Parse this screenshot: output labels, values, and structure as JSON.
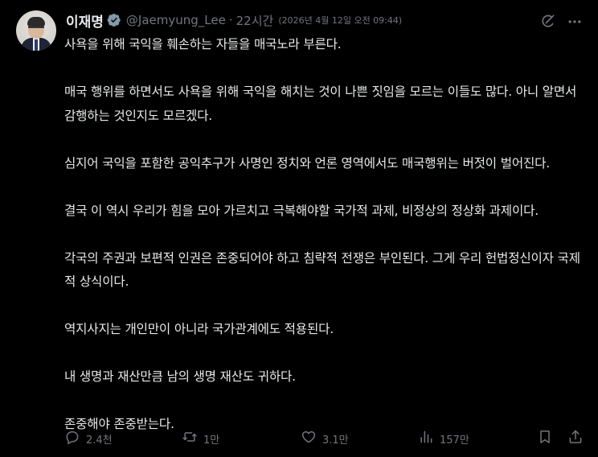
{
  "author": {
    "display_name": "이재명",
    "handle": "@Jaemyung_Lee",
    "verified": true
  },
  "timestamp": {
    "separator": "·",
    "relative": "22시간",
    "full": "(2026년 4월 12일 오전 09:44)"
  },
  "post": {
    "paragraphs": [
      "사욕을 위해 국익을 훼손하는 자들을 매국노라 부른다.",
      "매국 행위를 하면서도 사욕을 위해 국익을 해치는 것이 나쁜 짓임을 모르는 이들도 많다. 아니 알면서 감행하는 것인지도 모르겠다.",
      "심지어 국익을 포함한 공익추구가 사명인 정치와 언론 영역에서도 매국행위는 버젓이 벌어진다.",
      "결국 이 역시 우리가 힘을 모아 가르치고 극복해야할 국가적 과제, 비정상의 정상화 과제이다.",
      "각국의 주권과 보편적 인권은 존중되어야 하고 침략적 전쟁은 부인된다. 그게 우리 헌법정신이자 국제적 상식이다.",
      "역지사지는 개인만이 아니라 국가관계에도 적용된다.",
      "내 생명과 재산만큼 남의 생명 재산도 귀하다.",
      "존중해야 존중받는다."
    ]
  },
  "actions": {
    "replies": "2.4천",
    "reposts": "1만",
    "likes": "3.1만",
    "views": "157만"
  },
  "icons": {
    "verified": "verified-badge-icon",
    "grok": "grok-icon",
    "more": "more-icon",
    "reply": "reply-icon",
    "repost": "repost-icon",
    "like": "heart-icon",
    "views": "views-icon",
    "bookmark": "bookmark-icon",
    "share": "share-icon"
  },
  "colors": {
    "background": "#000000",
    "text": "#e7e9ea",
    "secondary": "#71767b",
    "verified_badge": "#829aab"
  }
}
